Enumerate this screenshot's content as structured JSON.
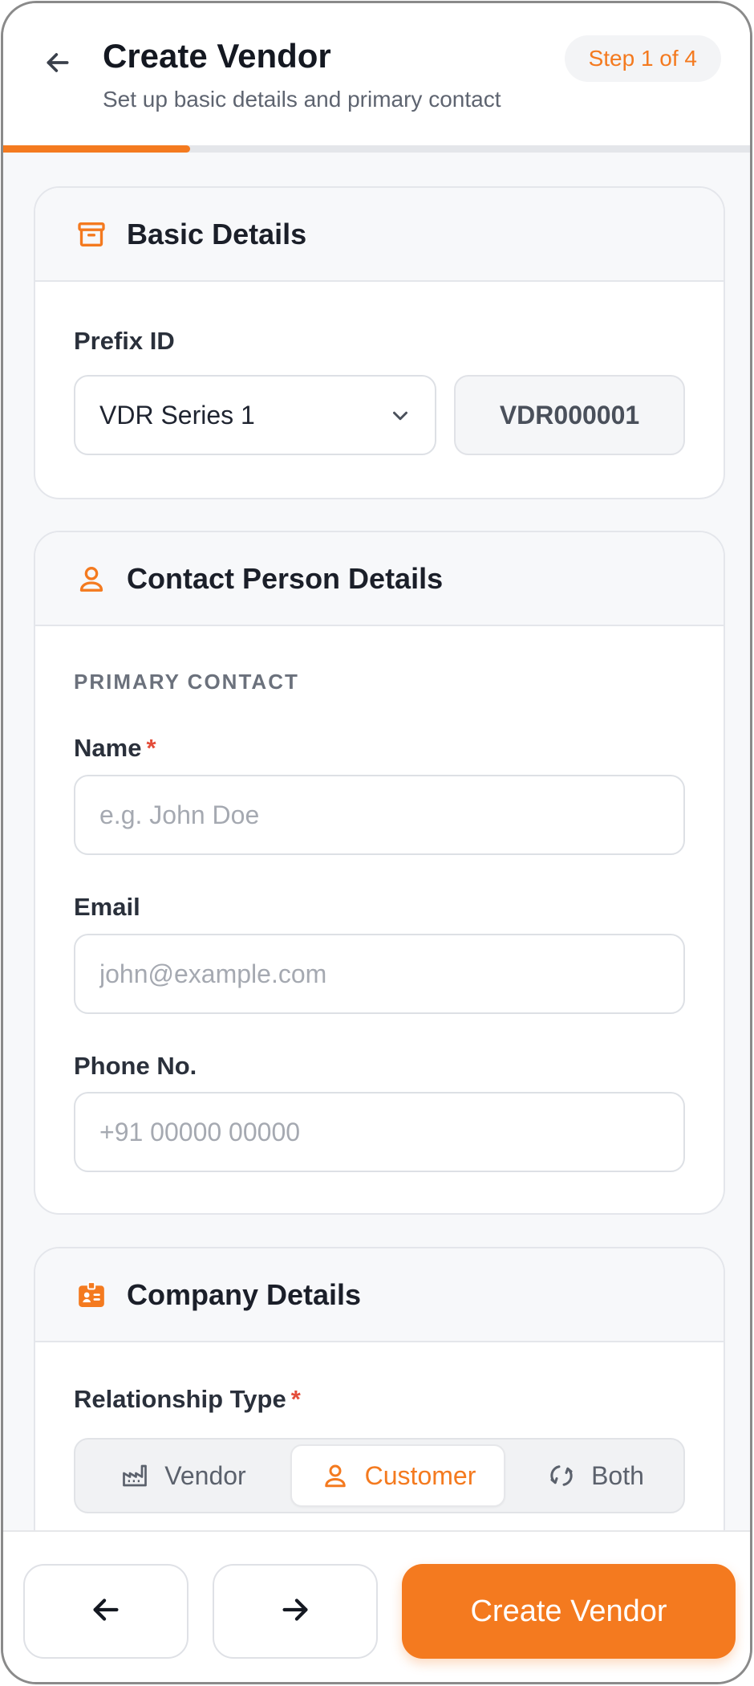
{
  "header": {
    "title": "Create Vendor",
    "subtitle": "Set up basic details and primary contact",
    "step_badge": "Step 1 of 4",
    "progress_fraction": 0.25,
    "accent_color": "#f47a1f"
  },
  "basic_details": {
    "title": "Basic Details",
    "icon": "archive-icon",
    "prefix_label": "Prefix ID",
    "prefix_selected": "VDR Series 1",
    "generated_id": "VDR000001"
  },
  "contact_details": {
    "title": "Contact Person Details",
    "icon": "user-icon",
    "section_caption": "PRIMARY CONTACT",
    "name_label": "Name",
    "name_required_mark": "*",
    "name_placeholder": "e.g. John Doe",
    "email_label": "Email",
    "email_placeholder": "john@example.com",
    "phone_label": "Phone No.",
    "phone_placeholder": "+91 00000 00000"
  },
  "company_details": {
    "title": "Company Details",
    "icon": "id-badge-icon",
    "relationship_label": "Relationship Type",
    "relationship_required_mark": "*",
    "relationship_options": [
      {
        "label": "Vendor",
        "icon": "factory-icon",
        "selected": false
      },
      {
        "label": "Customer",
        "icon": "user-icon",
        "selected": true
      },
      {
        "label": "Both",
        "icon": "swap-icon",
        "selected": false
      }
    ]
  },
  "footer": {
    "prev_icon": "arrow-left-icon",
    "next_icon": "arrow-right-icon",
    "primary_label": "Create Vendor"
  }
}
